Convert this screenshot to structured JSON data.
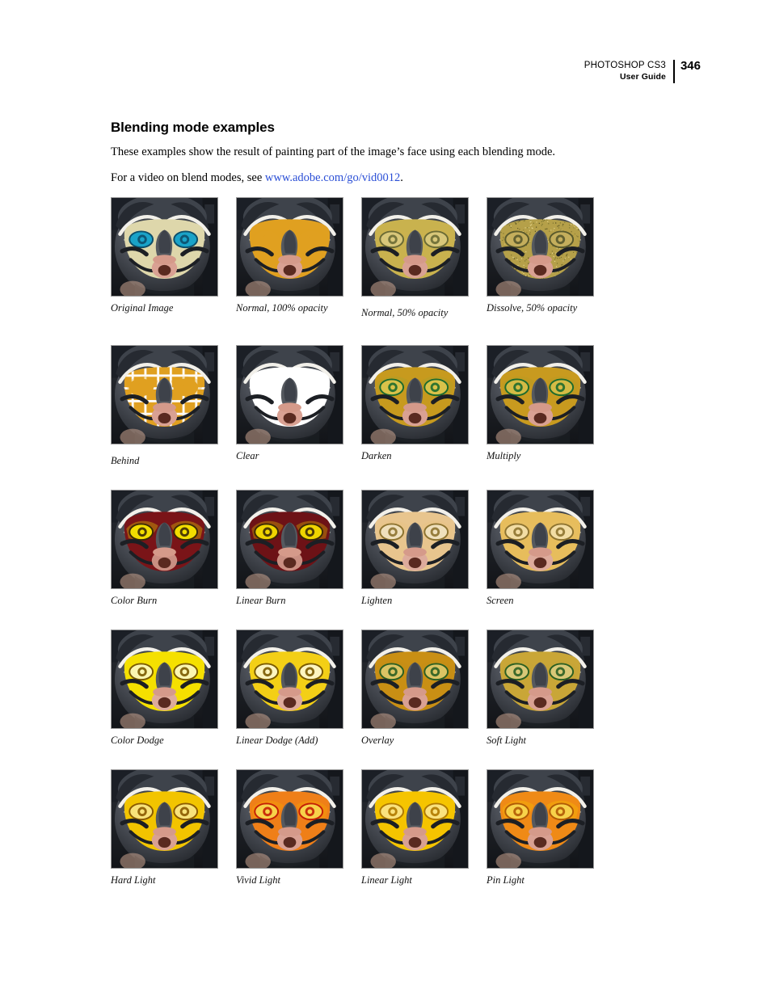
{
  "header": {
    "product": "PHOTOSHOP CS3",
    "guide": "User Guide",
    "page_number": "346"
  },
  "content": {
    "title": "Blending mode examples",
    "intro": "These examples show the result of painting part of the image’s face using each blending mode.",
    "video_prefix": "For a video on blend modes, see ",
    "video_link": "www.adobe.com/go/vid0012",
    "video_suffix": "."
  },
  "palette": {
    "link": "#2b4fd6",
    "gold": "#e0a020",
    "yellow": "#f5d400",
    "olive": "#b09020",
    "maroon": "#7a1418",
    "orange": "#ef7f18",
    "teal": "#1aa3c8",
    "cream": "#e3dcb4",
    "dark": "#3a3c40",
    "pink": "#e0a99a"
  },
  "examples": [
    [
      {
        "caption": "Original Image",
        "variant": "original",
        "caption_drop": false
      },
      {
        "caption": "Normal, 100% opacity",
        "variant": "normal100",
        "caption_drop": false
      },
      {
        "caption": "Normal, 50% opacity",
        "variant": "normal50",
        "caption_drop": true
      },
      {
        "caption": "Dissolve, 50% opacity",
        "variant": "dissolve50",
        "caption_drop": false
      }
    ],
    [
      {
        "caption": "Behind",
        "variant": "behind",
        "caption_drop": true
      },
      {
        "caption": "Clear",
        "variant": "clear",
        "caption_drop": false
      },
      {
        "caption": "Darken",
        "variant": "darken",
        "caption_drop": false
      },
      {
        "caption": "Multiply",
        "variant": "multiply",
        "caption_drop": false
      }
    ],
    [
      {
        "caption": "Color Burn",
        "variant": "colorburn",
        "caption_drop": false
      },
      {
        "caption": "Linear Burn",
        "variant": "linearburn",
        "caption_drop": false
      },
      {
        "caption": "Lighten",
        "variant": "lighten",
        "caption_drop": false
      },
      {
        "caption": "Screen",
        "variant": "screen",
        "caption_drop": false
      }
    ],
    [
      {
        "caption": "Color Dodge",
        "variant": "colordodge",
        "caption_drop": false
      },
      {
        "caption": "Linear Dodge (Add)",
        "variant": "lineardodge",
        "caption_drop": false
      },
      {
        "caption": "Overlay",
        "variant": "overlay",
        "caption_drop": false
      },
      {
        "caption": "Soft Light",
        "variant": "softlight",
        "caption_drop": false
      }
    ],
    [
      {
        "caption": "Hard Light",
        "variant": "hardlight",
        "caption_drop": false
      },
      {
        "caption": "Vivid Light",
        "variant": "vividlight",
        "caption_drop": false
      },
      {
        "caption": "Linear Light",
        "variant": "linearlight",
        "caption_drop": false
      },
      {
        "caption": "Pin Light",
        "variant": "pinlight",
        "caption_drop": false
      }
    ]
  ]
}
